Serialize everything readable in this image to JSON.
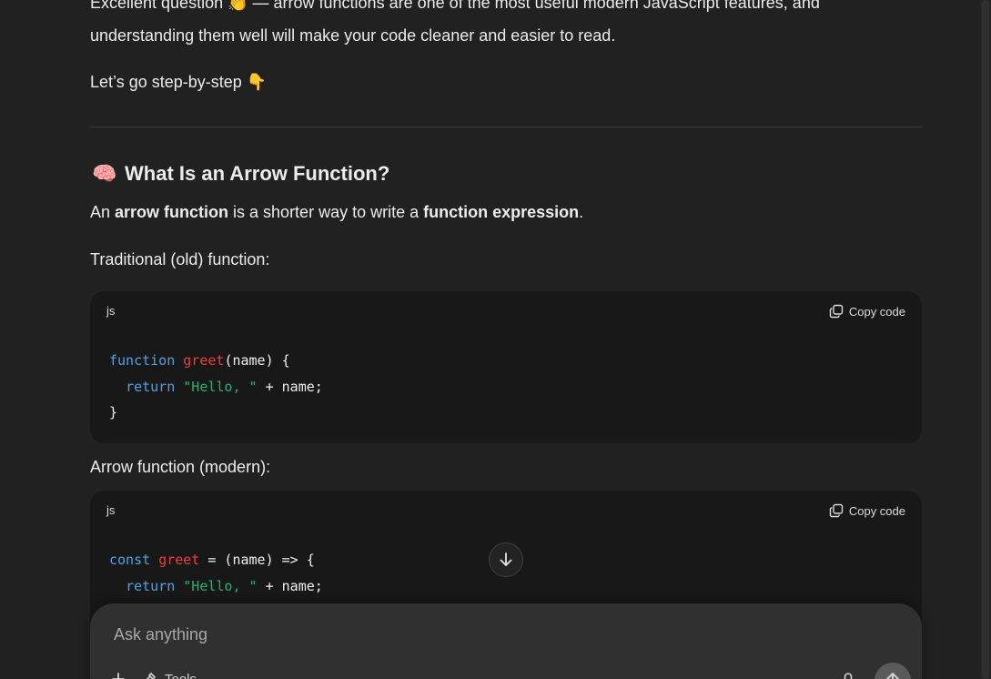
{
  "message": {
    "intro_line1_pre": "Excellent question ",
    "intro_line1_emoji": "👏",
    "intro_line1_post": " — arrow functions are one of the most useful modern JavaScript features, and",
    "intro_line2": "understanding them well will make your code cleaner and easier to read.",
    "step_text": "Let’s go step-by-step ",
    "step_emoji": "👇",
    "heading_emoji": "🧠",
    "heading": "What Is an Arrow Function?",
    "def_1": "An ",
    "def_2": "arrow function",
    "def_3": " is a shorter way to write a ",
    "def_4": "function expression",
    "def_5": ".",
    "traditional_label": "Traditional (old) function:",
    "arrow_label": "Arrow function (modern):"
  },
  "code_blocks": [
    {
      "lang": "js",
      "copy_label": "Copy code",
      "l1_kw": "function",
      "l1_fn": "greet",
      "l1_rest": "(name) {",
      "l2_kw": "return",
      "l2_str": "\"Hello, \"",
      "l2_rest": " + name;",
      "l3": "}"
    },
    {
      "lang": "js",
      "copy_label": "Copy code",
      "l1_kw": "const",
      "l1_fn": "greet",
      "l1_rest": " = (name) => {",
      "l2_kw": "return",
      "l2_str": "\"Hello, \"",
      "l2_rest": " + name;"
    }
  ],
  "composer": {
    "placeholder": "Ask anything",
    "tools_label": "Tools"
  },
  "icons": {
    "copy": "copy-icon",
    "scroll_down": "arrow-down-icon",
    "add": "plus-icon",
    "tools": "tools-icon",
    "mic": "microphone-icon",
    "send": "send-icon"
  }
}
